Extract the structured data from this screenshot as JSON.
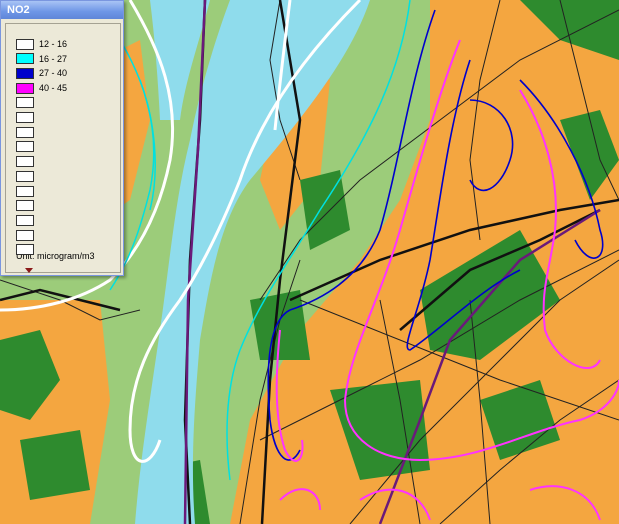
{
  "legend": {
    "title": "NO2",
    "unit": "Unit: microgram/m3",
    "entries": [
      {
        "label": "12 - 16",
        "color": "#ffffff"
      },
      {
        "label": "16 - 27",
        "color": "#00ffff"
      },
      {
        "label": "27 - 40",
        "color": "#0000cc"
      },
      {
        "label": "40 - 45",
        "color": "#ff00ff"
      },
      {
        "label": "",
        "color": "#ffffff"
      },
      {
        "label": "",
        "color": "#ffffff"
      },
      {
        "label": "",
        "color": "#ffffff"
      },
      {
        "label": "",
        "color": "#ffffff"
      },
      {
        "label": "",
        "color": "#ffffff"
      },
      {
        "label": "",
        "color": "#ffffff"
      },
      {
        "label": "",
        "color": "#ffffff"
      },
      {
        "label": "",
        "color": "#ffffff"
      },
      {
        "label": "",
        "color": "#ffffff"
      },
      {
        "label": "",
        "color": "#ffffff"
      },
      {
        "label": "",
        "color": "#ffffff"
      }
    ]
  },
  "map_colors": {
    "river": "#8fdcec",
    "grass": "#9ccc7a",
    "forest": "#2e8b2e",
    "urban": "#f4a640",
    "road": "#222222",
    "rail": "#5a1a6a"
  }
}
